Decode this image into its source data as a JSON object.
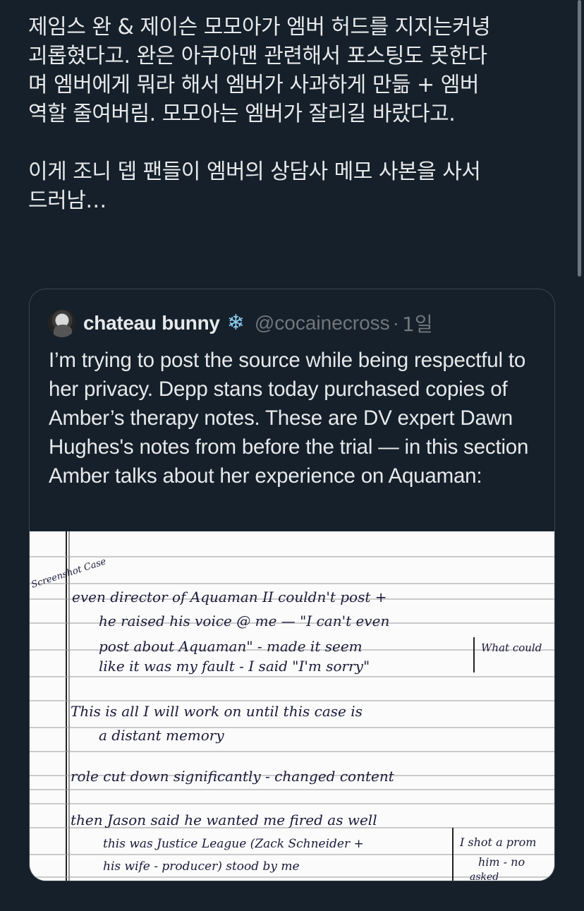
{
  "tweet": {
    "paragraphs": [
      "제임스 완 & 제이슨 모모아가 엠버 허드를 지지는커녕\n괴롭혔다고. 완은 아쿠아맨 관련해서 포스팅도 못한다\n며 엠버에게 뭐라 해서 엠버가 사과하게 만듦 + 엠버\n역할 줄여버림. 모모아는 엠버가 잘리길 바랐다고.",
      "이게 조니 뎁 팬들이 엠버의 상담사 메모 사본을 사서\n드러남…"
    ]
  },
  "quote": {
    "display_name": "chateau bunny",
    "badge_icon": "snowflake-icon",
    "handle": "@cocainecross",
    "separator": "·",
    "timestamp": "1일",
    "text": "I’m trying to post the source while being respectful to her privacy. Depp stans today purchased copies of Amber’s therapy notes. These are DV expert Dawn Hughes's notes from before the trial — in this section Amber talks about her experience on Aquaman:",
    "image_notes": {
      "margin_note": "Screenshot Case",
      "lines": [
        "even director of Aquaman II couldn't post +",
        "he raised his voice @ me — \"I can't even",
        "post about Aquaman\" - made it seem",
        "like it was my fault - I said \"I'm sorry\"",
        "This is all I will work on until this case is",
        "a distant memory",
        "role cut down significantly - changed content",
        "then Jason said he wanted me fired as well",
        "this was Justice League (Zack Schneider +",
        "his wife - producer) stood by me"
      ],
      "side_notes": [
        "What could",
        "I shot a prom",
        "him - no",
        "asked"
      ]
    }
  },
  "colors": {
    "background": "#15202b",
    "text": "#e7e9ea",
    "secondary": "#71767b",
    "border": "#38444d"
  }
}
